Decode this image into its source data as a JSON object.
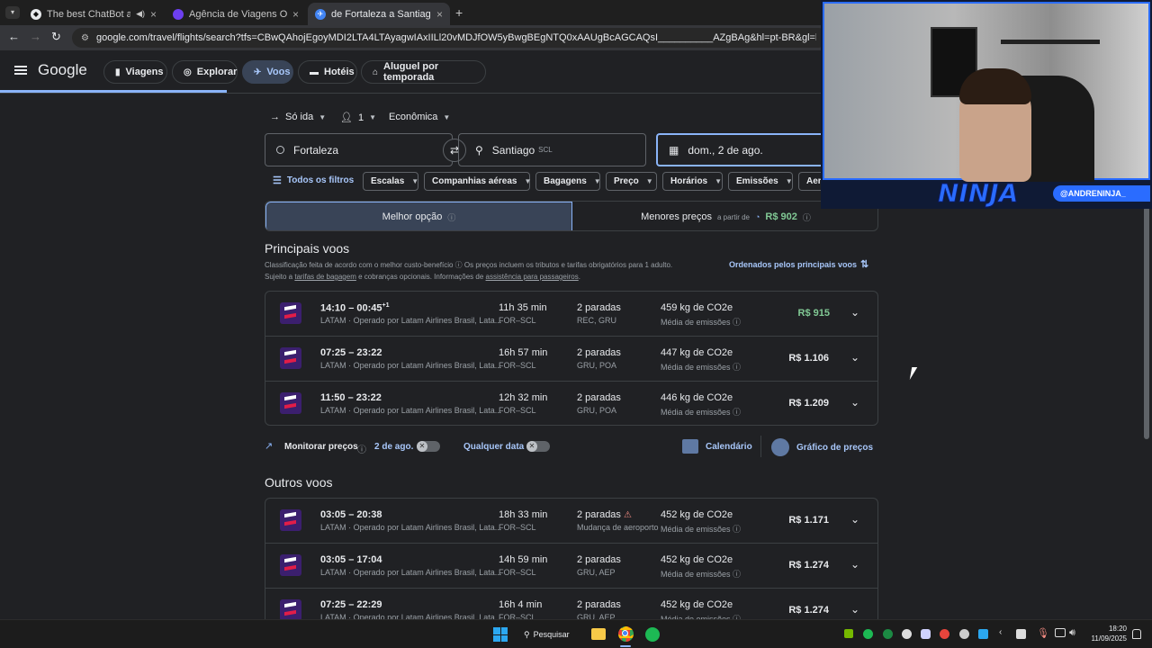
{
  "browser": {
    "tabs": [
      {
        "title": "The best ChatBot and Widg"
      },
      {
        "title": "Agência de Viagens Online con"
      },
      {
        "title": "de Fortaleza a Santiago | Googl"
      }
    ],
    "url": "google.com/travel/flights/search?tfs=CBwQAhojEgoyMDI2LTA4LTAyagwIAxIILl20vMDJfOW5yBwgBEgNTQ0xAAUgBcAGCAQsI__________AZgBAg&hl=pt-BR&gl=br&curr=BRL"
  },
  "header": {
    "logo": "Google",
    "nav": [
      "Viagens",
      "Explorar",
      "Voos",
      "Hotéis",
      "Aluguel por temporada"
    ],
    "selected_nav": "Voos"
  },
  "search": {
    "trip_type": "Só ida",
    "passengers": "1",
    "cabin": "Econômica",
    "origin": "Fortaleza",
    "destination": "Santiago",
    "destination_code": "SCL",
    "date": "dom., 2 de ago."
  },
  "filters": {
    "all_filters": "Todos os filtros",
    "chips": [
      "Escalas",
      "Companhias aéreas",
      "Bagagens",
      "Preço",
      "Horários",
      "Emissões",
      "Aer"
    ]
  },
  "sort_tabs": {
    "best": "Melhor opção",
    "cheapest": "Menores preços",
    "from_label": "a partir de",
    "cheapest_price": "R$ 902"
  },
  "main_flights": {
    "title": "Principais voos",
    "desc1": "Classificação feita de acordo com o melhor custo-benefício",
    "desc2": "Os preços incluem os tributos e tarifas obrigatórios para 1 adulto.",
    "desc3a": "Sujeito a",
    "desc3_link1": "tarifas de bagagem",
    "desc3b": "e cobranças opcionais. Informações de",
    "desc3_link2": "assistência para passageiros",
    "sorted_label": "Ordenados pelos principais voos",
    "flights": [
      {
        "times": "14:10 – 00:45",
        "plus": "+1",
        "airline": "LATAM · Operado por Latam Airlines Brasil, Lata...",
        "duration": "11h 35 min",
        "route": "FOR–SCL",
        "stops": "2 paradas",
        "stops_detail": "REC, GRU",
        "co2": "459 kg de CO2e",
        "co2_label": "Média de emissões",
        "price": "R$ 915",
        "price_color": "#81c995"
      },
      {
        "times": "07:25 – 23:22",
        "plus": "",
        "airline": "LATAM · Operado por Latam Airlines Brasil, Lata...",
        "duration": "16h 57 min",
        "route": "FOR–SCL",
        "stops": "2 paradas",
        "stops_detail": "GRU, POA",
        "co2": "447 kg de CO2e",
        "co2_label": "Média de emissões",
        "price": "R$ 1.106",
        "price_color": "#e8eaed"
      },
      {
        "times": "11:50 – 23:22",
        "plus": "",
        "airline": "LATAM · Operado por Latam Airlines Brasil, Lata...",
        "duration": "12h 32 min",
        "route": "FOR–SCL",
        "stops": "2 paradas",
        "stops_detail": "GRU, POA",
        "co2": "446 kg de CO2e",
        "co2_label": "Média de emissões",
        "price": "R$ 1.209",
        "price_color": "#e8eaed"
      }
    ]
  },
  "tracking": {
    "monitor": "Monitorar preços",
    "date_label": "2 de ago.",
    "any_date": "Qualquer data",
    "calendar": "Calendário",
    "price_graph": "Gráfico de preços"
  },
  "other_flights": {
    "title": "Outros voos",
    "flights": [
      {
        "times": "03:05 – 20:38",
        "airline": "LATAM · Operado por Latam Airlines Brasil, Lata...",
        "duration": "18h 33 min",
        "route": "FOR–SCL",
        "stops": "2 paradas",
        "stops_detail": "Mudança de aeroporto",
        "warning": true,
        "co2": "452 kg de CO2e",
        "co2_label": "Média de emissões",
        "price": "R$ 1.171"
      },
      {
        "times": "03:05 – 17:04",
        "airline": "LATAM · Operado por Latam Airlines Brasil, Lata...",
        "duration": "14h 59 min",
        "route": "FOR–SCL",
        "stops": "2 paradas",
        "stops_detail": "GRU, AEP",
        "warning": false,
        "co2": "452 kg de CO2e",
        "co2_label": "Média de emissões",
        "price": "R$ 1.274"
      },
      {
        "times": "07:25 – 22:29",
        "airline": "LATAM · Operado por Latam Airlines Brasil, Lata...",
        "duration": "16h 4 min",
        "route": "FOR–SCL",
        "stops": "2 paradas",
        "stops_detail": "GRU, AEP",
        "warning": false,
        "co2": "452 kg de CO2e",
        "co2_label": "Média de emissões",
        "price": "R$ 1.274"
      }
    ]
  },
  "overlay": {
    "handle": "@ANDRENINJA_",
    "logo_text": "NINJA"
  },
  "taskbar": {
    "search": "Pesquisar",
    "time": "18:20",
    "date": "11/09/2025"
  }
}
